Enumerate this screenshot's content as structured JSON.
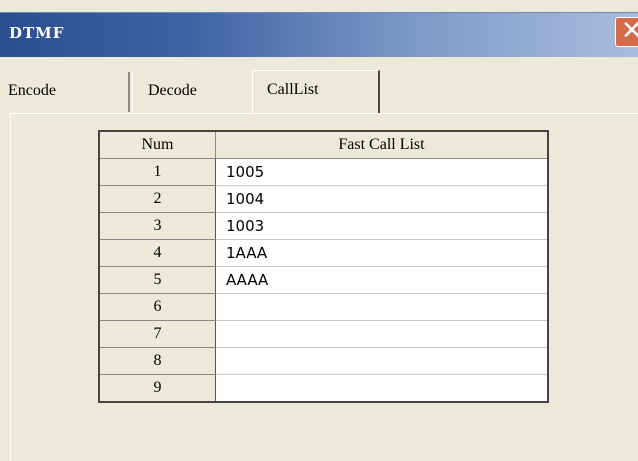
{
  "window": {
    "title": "DTMF",
    "close_icon": "close-icon"
  },
  "tabs": [
    {
      "label": "Encode",
      "active": false
    },
    {
      "label": "Decode",
      "active": false
    },
    {
      "label": "CallList",
      "active": true
    }
  ],
  "table": {
    "headers": [
      "Num",
      "Fast Call List"
    ],
    "rows": [
      {
        "num": "1",
        "value": "1005"
      },
      {
        "num": "2",
        "value": "1004"
      },
      {
        "num": "3",
        "value": "1003"
      },
      {
        "num": "4",
        "value": "1AAA"
      },
      {
        "num": "5",
        "value": "AAAA"
      },
      {
        "num": "6",
        "value": ""
      },
      {
        "num": "7",
        "value": ""
      },
      {
        "num": "8",
        "value": ""
      },
      {
        "num": "9",
        "value": ""
      }
    ]
  },
  "colors": {
    "face": "#ECE9D8",
    "title_start": "#2A4E8F",
    "title_end": "#A9BCDD",
    "close": "#D36A4A"
  }
}
